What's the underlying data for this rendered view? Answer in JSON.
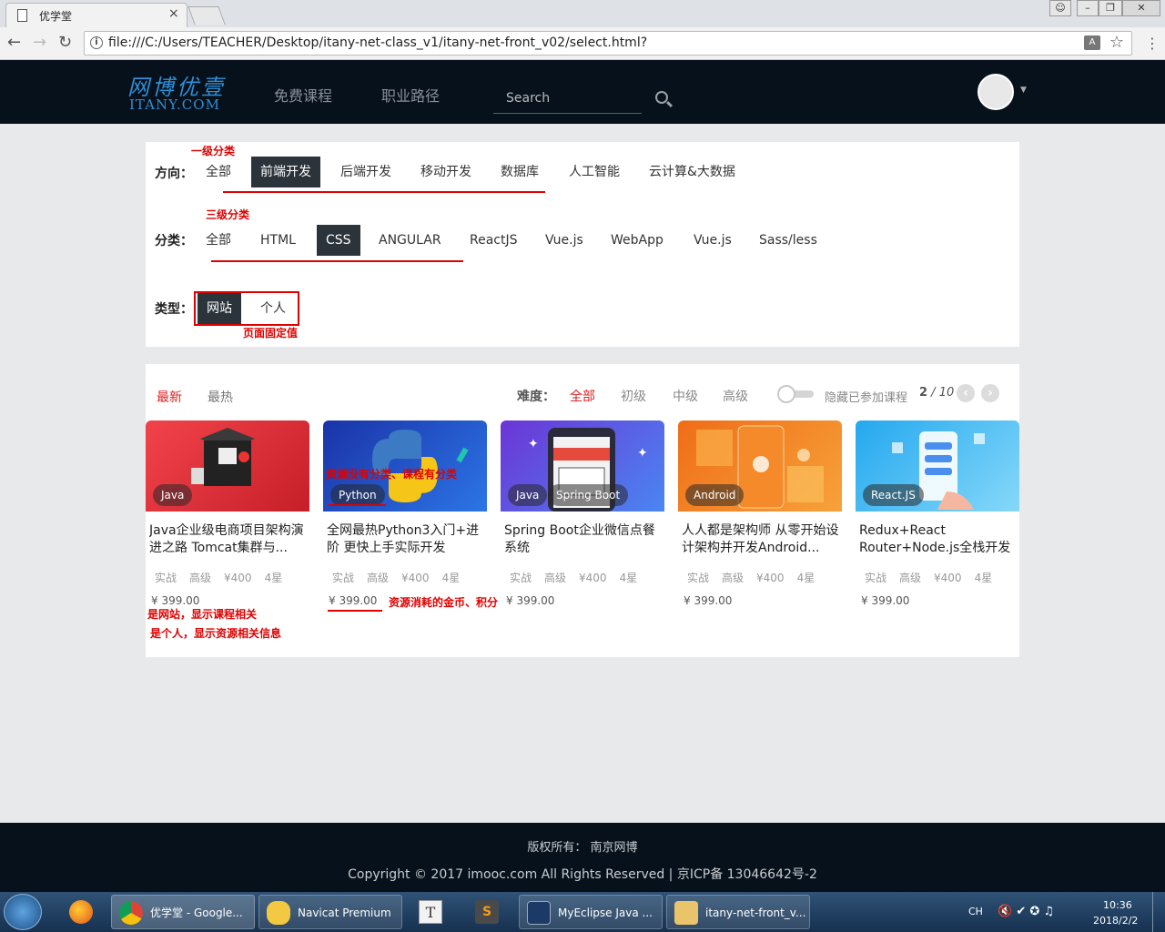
{
  "browser": {
    "tab_title": "优学堂",
    "tab_close": "×",
    "url": "file:///C:/Users/TEACHER/Desktop/itany-net-class_v1/itany-net-front_v02/select.html?"
  },
  "header": {
    "logo_cn": "网博优壹",
    "logo_en": "ITANY.COM",
    "nav": [
      "免费课程",
      "职业路径"
    ],
    "search_placeholder": "Search"
  },
  "filters": {
    "direction_label": "方向：",
    "direction_items": [
      "全部",
      "前端开发",
      "后端开发",
      "移动开发",
      "数据库",
      "人工智能",
      "云计算&大数据"
    ],
    "category_label": "分类：",
    "category_items": [
      "全部",
      "HTML",
      "CSS",
      "ANGULAR",
      "ReactJS",
      "Vue.js",
      "WebApp",
      "Vue.js",
      "Sass/less"
    ],
    "type_label": "类型：",
    "type_items": [
      "网站",
      "个人"
    ]
  },
  "annotations": {
    "level1": "一级分类",
    "level3": "三级分类",
    "fixed": "页面固定值",
    "resource": "资源没有分类、课程有分类",
    "cost": "资源消耗的金币、积分",
    "site_info": "是网站，显示课程相关",
    "personal_info": "是个人，显示资源相关信息"
  },
  "courses": {
    "sort_tabs": [
      "最新",
      "最热"
    ],
    "difficulty_label": "难度：",
    "difficulty_items": [
      "全部",
      "初级",
      "中级",
      "高级"
    ],
    "hide_joined": "隐藏已参加课程",
    "page_current": "2",
    "page_sep": " / ",
    "page_total": "10",
    "items": [
      {
        "tag": "Java",
        "title": "Java企业级电商项目架构演进之路 Tomcat集群与...",
        "type": "实战",
        "level": "高级",
        "students": "¥400",
        "stars": "4星",
        "price": "¥ 399.00",
        "color1": "#e8323c",
        "color2": "#c9202a"
      },
      {
        "tag": "Python",
        "title": "全网最热Python3入门+进阶 更快上手实际开发",
        "type": "实战",
        "level": "高级",
        "students": "¥400",
        "stars": "4星",
        "price": "¥ 399.00",
        "color1": "#1e3fb8",
        "color2": "#2a6de0"
      },
      {
        "tag": "Java",
        "tag2": "Spring Boot",
        "title": "Spring Boot企业微信点餐系统",
        "type": "实战",
        "level": "高级",
        "students": "¥400",
        "stars": "4星",
        "price": "¥ 399.00",
        "color1": "#6a3cd8",
        "color2": "#4b7ef0"
      },
      {
        "tag": "Android",
        "title": "人人都是架构师 从零开始设计架构并开发Android...",
        "type": "实战",
        "level": "高级",
        "students": "¥400",
        "stars": "4星",
        "price": "¥ 399.00",
        "color1": "#f07a1c",
        "color2": "#f59a30"
      },
      {
        "tag": "React.JS",
        "title": "Redux+React Router+Node.js全栈开发",
        "type": "实战",
        "level": "高级",
        "students": "¥400",
        "stars": "4星",
        "price": "¥ 399.00",
        "color1": "#2ab0f0",
        "color2": "#7fd4f8"
      }
    ]
  },
  "footer": {
    "line1": "版权所有： 南京网博",
    "line2": "Copyright © 2017 imooc.com All Rights Reserved | 京ICP备 13046642号-2"
  },
  "taskbar": {
    "items": [
      "优学堂 - Google...",
      "Navicat Premium",
      "MyEclipse Java ...",
      "itany-net-front_v..."
    ],
    "lang": "CH",
    "time": "10:36",
    "date": "2018/2/2"
  },
  "colors": {
    "header_bg": "#07111b",
    "accent_red": "#e02020",
    "active_chip": "#2b333b",
    "logo_blue": "#2e8fd6"
  }
}
